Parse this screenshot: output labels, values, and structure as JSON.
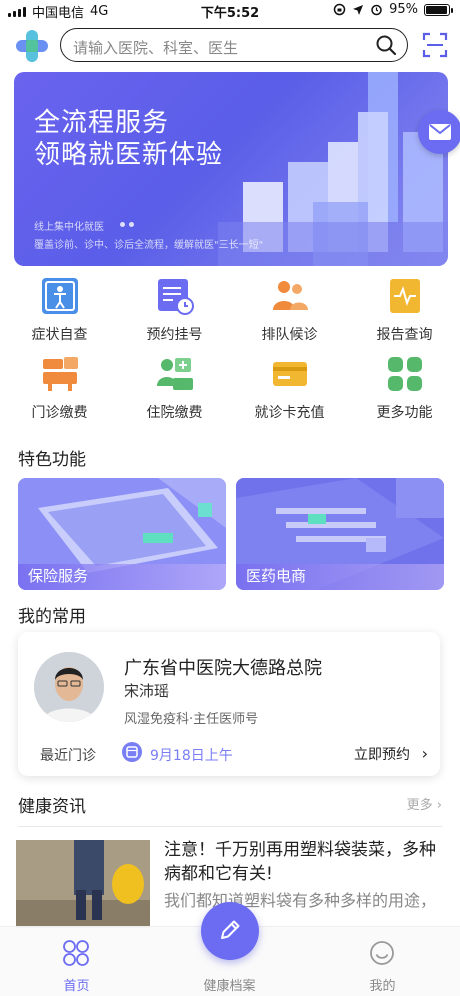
{
  "status_bar": {
    "carrier": "中国电信",
    "network": "4G",
    "time": "下午5:52",
    "battery": "95%",
    "battery_level": 0.95
  },
  "header": {
    "search_placeholder": "请输入医院、科室、医生",
    "logo_icon": "medical-cross-logo",
    "scan_icon": "scan-icon"
  },
  "banner": {
    "title_line1": "全流程服务",
    "title_line2": "领略就医新体验",
    "sub_line1": "线上集中化就医",
    "sub_line2": "覆盖诊前、诊中、诊后全流程，缓解就医\"三长一短\""
  },
  "grid": [
    {
      "label": "症状自查",
      "icon": "body-check-icon",
      "color": "#4a8fe7"
    },
    {
      "label": "预约挂号",
      "icon": "appointment-icon",
      "color": "#6b6cf2"
    },
    {
      "label": "排队候诊",
      "icon": "queue-icon",
      "color": "#f08a3c"
    },
    {
      "label": "报告查询",
      "icon": "report-icon",
      "color": "#f2b730"
    },
    {
      "label": "门诊缴费",
      "icon": "outpatient-pay-icon",
      "color": "#f08a3c"
    },
    {
      "label": "住院缴费",
      "icon": "inpatient-pay-icon",
      "color": "#55b86a"
    },
    {
      "label": "就诊卡充值",
      "icon": "card-recharge-icon",
      "color": "#f2b730"
    },
    {
      "label": "更多功能",
      "icon": "more-apps-icon",
      "color": "#55b86a"
    }
  ],
  "features": {
    "title": "特色功能",
    "items": [
      {
        "label": "保险服务"
      },
      {
        "label": "医药电商"
      }
    ]
  },
  "favorites": {
    "title": "我的常用",
    "hospital": "广东省中医院大德路总院",
    "doctor": "宋沛瑶",
    "department": "风湿免疫科·主任医师号",
    "recent_label": "最近门诊",
    "recent_date": "9月18日上午",
    "book_label": "立即预约"
  },
  "news": {
    "title": "健康资讯",
    "more": "更多",
    "item_title": "注意！千万别再用塑料袋装菜，多种病都和它有关!",
    "item_desc": "我们都知道塑料袋有多种多样的用途，"
  },
  "tabbar": {
    "tabs": [
      {
        "label": "首页",
        "active": true
      },
      {
        "label": "健康档案",
        "active": false
      },
      {
        "label": "我的",
        "active": false
      }
    ],
    "fab_icon": "pencil-icon"
  }
}
